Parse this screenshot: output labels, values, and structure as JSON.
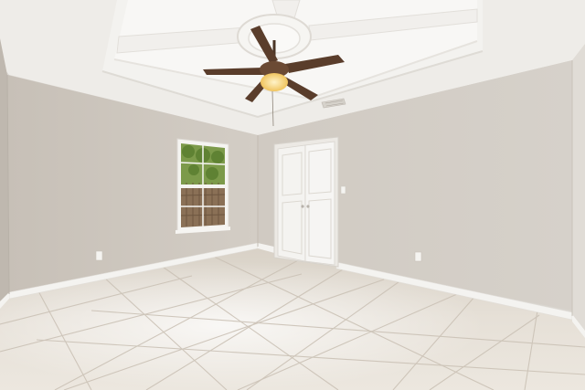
{
  "scene": {
    "subject": "empty-room",
    "colors": {
      "wall_left": "#cfc9c1",
      "wall_back": "#d2ccc4",
      "wall_right": "#d8d3cc",
      "ceiling": "#efedea",
      "tray_ceiling": "#f7f6f4",
      "baseboard": "#f4f3f0",
      "floor": "#e4ddd3",
      "floor_grout": "#c9c0b4",
      "door": "#f3f2ef",
      "fan_blade": "#5a3d2b",
      "fan_light": "#f3cf7a",
      "window_green": "#6f8f3e",
      "fence": "#8a7056"
    }
  }
}
